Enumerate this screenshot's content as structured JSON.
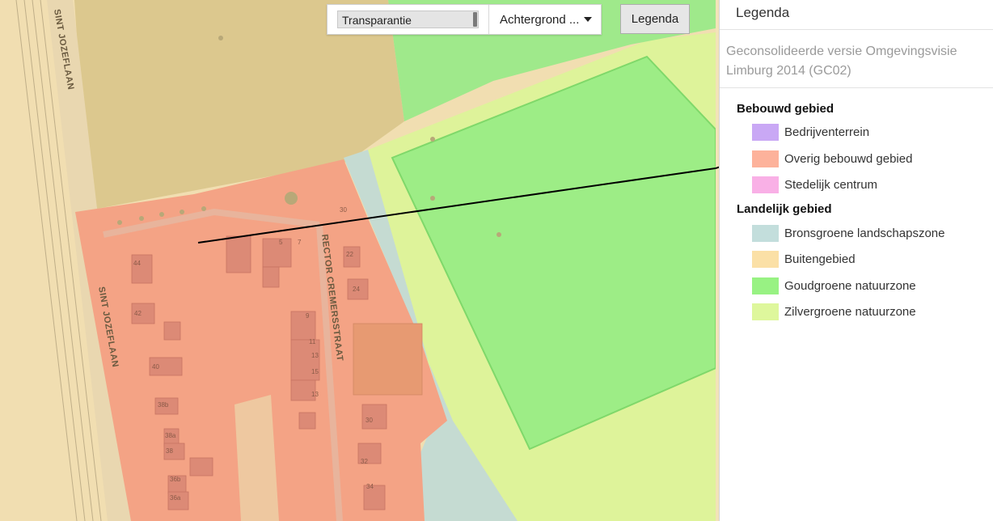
{
  "toolbar": {
    "transparency_label": "Transparantie",
    "transparency_value": 1.0,
    "background_label": "Achtergrond ...",
    "legend_button": "Legenda"
  },
  "map": {
    "street_names": [
      "SINT JOZEFLAAN",
      "SINT JOZEFLAAN",
      "RECTOR CREMERSSTRAAT"
    ],
    "house_numbers": [
      "44",
      "42",
      "40",
      "38b",
      "38a",
      "38",
      "36b",
      "36a",
      "5",
      "7",
      "9",
      "11",
      "13",
      "13",
      "15",
      "30",
      "22",
      "24",
      "30",
      "32",
      "34"
    ]
  },
  "legend": {
    "title": "Legenda",
    "subtitle": "Geconsolideerde versie Omgevingsvisie Limburg 2014 (GC02)",
    "groups": [
      {
        "title": "Bebouwd gebied",
        "items": [
          {
            "label": "Bedrijventerrein",
            "color": "#c9a8f5"
          },
          {
            "label": "Overig bebouwd gebied",
            "color": "#fdb29b"
          },
          {
            "label": "Stedelijk centrum",
            "color": "#f9b0e6"
          }
        ]
      },
      {
        "title": "Landelijk gebied",
        "items": [
          {
            "label": "Bronsgroene landschapszone",
            "color": "#c3dedc"
          },
          {
            "label": "Buitengebied",
            "color": "#fbe0a6"
          },
          {
            "label": "Goudgroene natuurzone",
            "color": "#98f283"
          },
          {
            "label": "Zilvergroene natuurzone",
            "color": "#def79c"
          }
        ]
      }
    ]
  }
}
